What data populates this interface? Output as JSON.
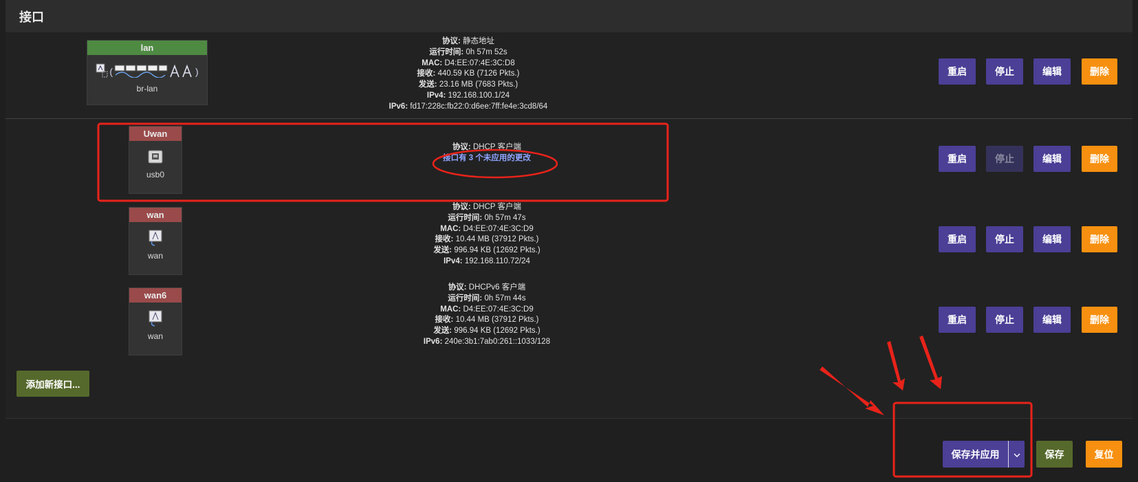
{
  "section_title": "接口",
  "buttons": {
    "restart": "重启",
    "stop": "停止",
    "edit": "编辑",
    "delete": "删除",
    "add_interface": "添加新接口...",
    "save_apply": "保存并应用",
    "save": "保存",
    "reset": "复位"
  },
  "interfaces": [
    {
      "name": "lan",
      "device": "br-lan",
      "header_color": "#4f8a43",
      "icons": [
        "wired-port-icon",
        "bridge-bracket-icon",
        "ethernet-port-icon",
        "wireless-icon"
      ],
      "bracket_open": "(",
      "bracket_close": ")",
      "info": {
        "protocol_label": "协议:",
        "protocol": "静态地址",
        "uptime_label": "运行时间:",
        "uptime": "0h 57m 52s",
        "mac_label": "MAC:",
        "mac": "D4:EE:07:4E:3C:D8",
        "rx_label": "接收:",
        "rx": "440.59 KB (7126 Pkts.)",
        "tx_label": "发送:",
        "tx": "23.16 MB (7683 Pkts.)",
        "ip_label": "IPv4:",
        "ip": "192.168.100.1/24",
        "ip6_label": "IPv6:",
        "ip6": "fd17:228c:fb22:0:d6ee:7ff:fe4e:3cd8/64"
      }
    },
    {
      "name": "Uwan",
      "device": "usb0",
      "header_color": "#9a4a4a",
      "icons": [
        "usb-port-icon"
      ],
      "info": {
        "protocol_label": "协议:",
        "protocol": "DHCP 客户端",
        "pending": "接口有 3 个未应用的更改"
      }
    },
    {
      "name": "wan",
      "device": "wan",
      "header_color": "#9a4a4a",
      "icons": [
        "ethernet-cable-icon"
      ],
      "info": {
        "protocol_label": "协议:",
        "protocol": "DHCP 客户端",
        "uptime_label": "运行时间:",
        "uptime": "0h 57m 47s",
        "mac_label": "MAC:",
        "mac": "D4:EE:07:4E:3C:D9",
        "rx_label": "接收:",
        "rx": "10.44 MB (37912 Pkts.)",
        "tx_label": "发送:",
        "tx": "996.94 KB (12692 Pkts.)",
        "ip_label": "IPv4:",
        "ip": "192.168.110.72/24"
      }
    },
    {
      "name": "wan6",
      "device": "wan",
      "header_color": "#9a4a4a",
      "icons": [
        "ethernet-cable-icon"
      ],
      "info": {
        "protocol_label": "协议:",
        "protocol": "DHCPv6 客户端",
        "uptime_label": "运行时间:",
        "uptime": "0h 57m 44s",
        "mac_label": "MAC:",
        "mac": "D4:EE:07:4E:3C:D9",
        "rx_label": "接收:",
        "rx": "10.44 MB (37912 Pkts.)",
        "tx_label": "发送:",
        "tx": "996.94 KB (12692 Pkts.)",
        "ip6_label": "IPv6:",
        "ip6": "240e:3b1:7ab0:261::1033/128"
      }
    }
  ],
  "colors": {
    "primary": "#4b3f96",
    "danger": "#f79010",
    "positive": "#56692c",
    "annotation": "#e8231a"
  },
  "icons": {
    "dropdown": "chevron-down-icon"
  }
}
